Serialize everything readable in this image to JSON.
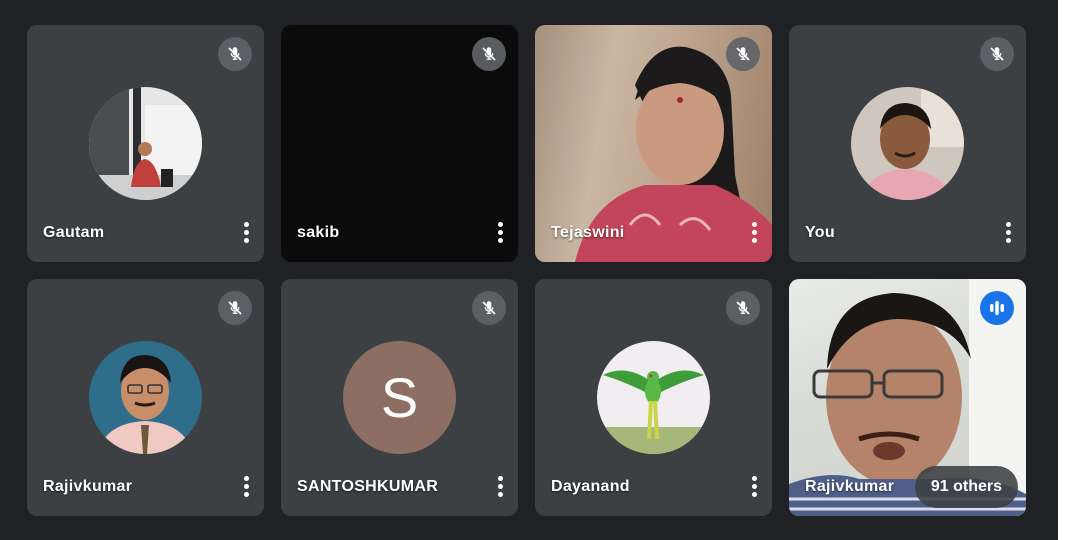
{
  "colors": {
    "background": "#202124",
    "tile": "#3c4043",
    "mute_badge": "#5f6368",
    "speaking_badge": "#1a73e8",
    "letter_avatar": "#8d6e63"
  },
  "participants": [
    {
      "name": "Gautam",
      "muted": true,
      "display": "photo-avatar",
      "icon": "mic-off-icon"
    },
    {
      "name": "sakib",
      "muted": true,
      "display": "video-off-black",
      "icon": "mic-off-icon"
    },
    {
      "name": "Tejaswini",
      "muted": true,
      "display": "video",
      "icon": "mic-off-icon"
    },
    {
      "name": "You",
      "muted": true,
      "display": "photo-avatar",
      "icon": "mic-off-icon"
    },
    {
      "name": "Rajivkumar",
      "muted": true,
      "display": "photo-avatar",
      "icon": "mic-off-icon"
    },
    {
      "name": "SANTOSHKUMAR",
      "muted": true,
      "display": "letter-avatar",
      "avatar_letter": "S",
      "icon": "mic-off-icon"
    },
    {
      "name": "Dayanand",
      "muted": true,
      "display": "photo-avatar",
      "icon": "mic-off-icon"
    },
    {
      "name": "Rajivkumar",
      "muted": false,
      "display": "video",
      "icon": "speaking-icon"
    }
  ],
  "others_chip": "91 others"
}
